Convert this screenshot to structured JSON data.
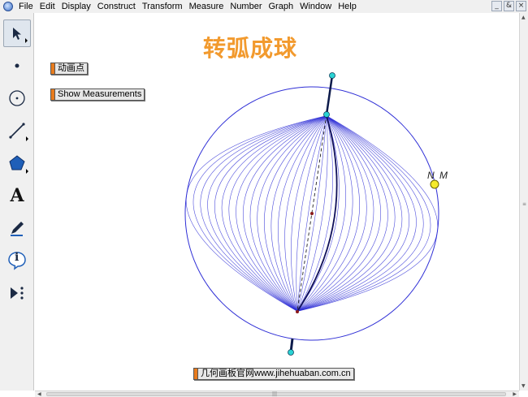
{
  "menu": [
    "File",
    "Edit",
    "Display",
    "Construct",
    "Transform",
    "Measure",
    "Number",
    "Graph",
    "Window",
    "Help"
  ],
  "window_controls": [
    "_",
    "&",
    "×"
  ],
  "tools": [
    {
      "name": "selection-arrow-tool",
      "icon": "arrow-icon"
    },
    {
      "name": "point-tool",
      "icon": "point-icon"
    },
    {
      "name": "compass-tool",
      "icon": "circle-icon"
    },
    {
      "name": "straightedge-tool",
      "icon": "line-icon"
    },
    {
      "name": "polygon-tool",
      "icon": "polygon-icon"
    },
    {
      "name": "text-tool",
      "icon": "text-icon",
      "glyph": "A"
    },
    {
      "name": "marker-tool",
      "icon": "pen-icon"
    },
    {
      "name": "information-tool",
      "icon": "info-icon",
      "glyph": "i"
    },
    {
      "name": "custom-tool",
      "icon": "custom-tools-icon"
    }
  ],
  "canvas": {
    "title": "转弧成球",
    "buttons": {
      "animate_point": "动画点",
      "show_measurements": "Show Measurements",
      "website": "几何画板官网www.jihehuaban.com.cn"
    },
    "point_labels": {
      "n": "N",
      "m": "M"
    }
  },
  "colors": {
    "title": "#f29a2e",
    "button_tab": "#e87b1c",
    "sphere_lines": "#2f2fd6",
    "point_cyan": "#2ad3d3",
    "point_yellow": "#f5ea2a"
  }
}
